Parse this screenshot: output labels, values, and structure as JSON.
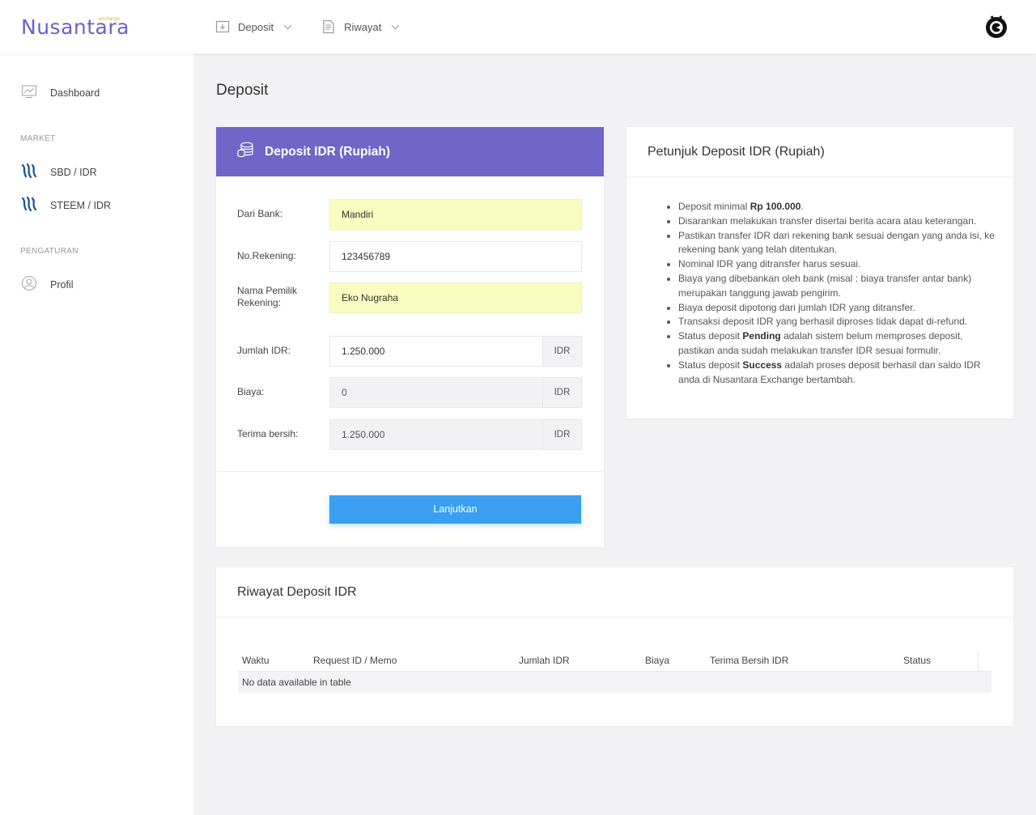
{
  "brand": {
    "name": "Nusantara",
    "tag": "exchange"
  },
  "topnav": [
    {
      "label": "Deposit",
      "icon": "deposit-icon"
    },
    {
      "label": "Riwayat",
      "icon": "history-icon"
    }
  ],
  "sidebar": {
    "dashboard": "Dashboard",
    "market_section": "MARKET",
    "market": [
      "SBD / IDR",
      "STEEM / IDR"
    ],
    "settings_section": "PENGATURAN",
    "profile": "Profil"
  },
  "page": {
    "title": "Deposit"
  },
  "deposit_form": {
    "title": "Deposit IDR (Rupiah)",
    "bank_label": "Dari Bank:",
    "bank_value": "Mandiri",
    "account_no_label": "No.Rekening:",
    "account_no_value": "123456789",
    "account_name_label_1": "Nama Pemilik",
    "account_name_label_2": "Rekening:",
    "account_name_value": "Eko Nugraha",
    "amount_label": "Jumlah IDR:",
    "amount_value": "1.250.000",
    "fee_label": "Biaya:",
    "fee_value": "0",
    "net_label": "Terima bersih:",
    "net_value": "1.250.000",
    "currency": "IDR",
    "submit_label": "Lanjutkan"
  },
  "guide": {
    "title": "Petunjuk Deposit IDR (Rupiah)",
    "items": [
      {
        "pre": "Deposit minimal ",
        "bold": "Rp 100.000",
        "post": "."
      },
      {
        "pre": "Disarankan melakukan transfer disertai berita acara atau keterangan.",
        "bold": "",
        "post": ""
      },
      {
        "pre": "Pastikan transfer IDR dari rekening bank sesuai dengan yang anda isi, ke rekening bank yang telah ditentukan.",
        "bold": "",
        "post": ""
      },
      {
        "pre": "Nominal IDR yang ditransfer harus sesuai.",
        "bold": "",
        "post": ""
      },
      {
        "pre": "Biaya yang dibebankan oleh bank (misal : biaya transfer antar bank) merupakan tanggung jawab pengirim.",
        "bold": "",
        "post": ""
      },
      {
        "pre": "Biaya deposit dipotong dari jumlah IDR yang ditransfer.",
        "bold": "",
        "post": ""
      },
      {
        "pre": "Transaksi deposit IDR yang berhasil diproses tidak dapat di-refund.",
        "bold": "",
        "post": ""
      },
      {
        "pre": "Status deposit ",
        "bold": "Pending",
        "post": " adalah sistem belum memproses deposit, pastikan anda sudah melakukan transfer IDR sesuai formulir."
      },
      {
        "pre": "Status deposit ",
        "bold": "Success",
        "post": " adalah proses deposit berhasil dan saldo IDR anda di Nusantara Exchange bertambah."
      }
    ]
  },
  "history": {
    "title": "Riwayat Deposit IDR",
    "columns": [
      "Waktu",
      "Request ID / Memo",
      "Jumlah IDR",
      "Biaya",
      "Terima Bersih IDR",
      "Status"
    ],
    "empty_text": "No data available in table"
  }
}
